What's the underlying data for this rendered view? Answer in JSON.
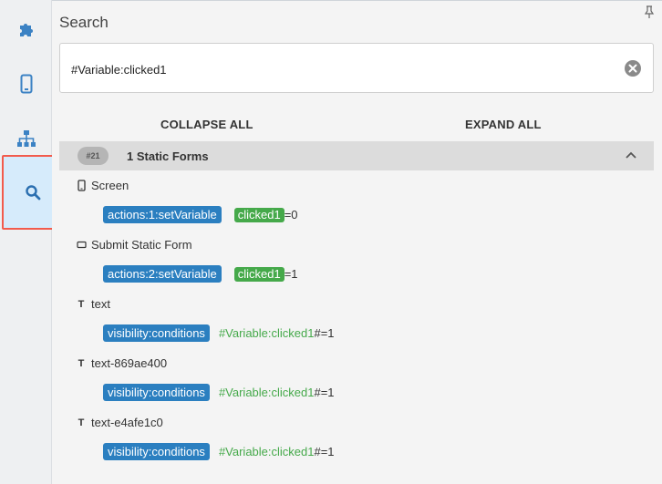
{
  "sidebar": {
    "items": [
      {
        "icon": "puzzle-icon",
        "active": false
      },
      {
        "icon": "mobile-icon",
        "active": false
      },
      {
        "icon": "sitemap-icon",
        "active": false
      },
      {
        "icon": "search-icon",
        "active": true
      }
    ]
  },
  "panel": {
    "title": "Search",
    "search": {
      "value": "#Variable:clicked1",
      "placeholder": ""
    },
    "collapse_all": "COLLAPSE ALL",
    "expand_all": "EXPAND ALL"
  },
  "group": {
    "badge": "#21",
    "title": "1 Static Forms",
    "items": [
      {
        "icon": "mobile-icon",
        "name": "Screen",
        "ref": "actions:1:setVariable",
        "variable": "clicked1",
        "suffix": "=0"
      },
      {
        "icon": "rectangle-icon",
        "name": "Submit Static Form",
        "ref": "actions:2:setVariable",
        "variable": "clicked1",
        "suffix": "=1"
      },
      {
        "icon": "text-icon",
        "name": "text",
        "ref": "visibility:conditions",
        "variable": "#Variable:clicked1",
        "suffix": "#=1"
      },
      {
        "icon": "text-icon",
        "name": "text-869ae400",
        "ref": "visibility:conditions",
        "variable": "#Variable:clicked1",
        "suffix": "#=1"
      },
      {
        "icon": "text-icon",
        "name": "text-e4afe1c0",
        "ref": "visibility:conditions",
        "variable": "#Variable:clicked1",
        "suffix": "#=1"
      }
    ]
  },
  "colors": {
    "accent_blue": "#2b7fc0",
    "match_green": "#45a94a",
    "active_highlight": "#f25b4c",
    "active_bg": "#d6ebfb"
  }
}
